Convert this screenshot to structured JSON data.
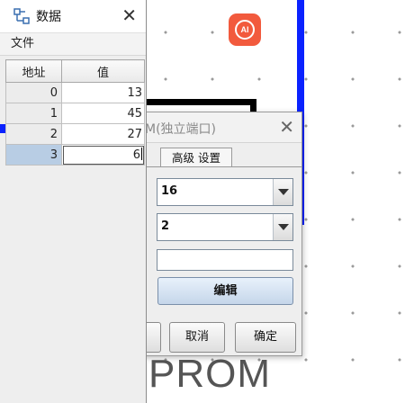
{
  "canvas": {
    "ai_button_label": "AI",
    "component_label": "PROM",
    "big_glyph": "0"
  },
  "data_window": {
    "title": "数据",
    "close_glyph": "✕",
    "menu": {
      "file": "文件"
    },
    "table": {
      "headers": {
        "address": "地址",
        "value": "值"
      },
      "rows": [
        {
          "address": "0",
          "value": "13"
        },
        {
          "address": "1",
          "value": "45"
        },
        {
          "address": "2",
          "value": "27"
        },
        {
          "address": "3",
          "value": "6",
          "selected": true
        }
      ]
    }
  },
  "dialog": {
    "title": "M(独立端口)",
    "close_glyph": "✕",
    "tab_advanced": "高级 设置",
    "combo1_value": "16",
    "combo2_value": "2",
    "edit_button": "编辑",
    "cancel_button": "取消",
    "ok_button": "确定"
  },
  "colors": {
    "ai_button": "#f25a3d",
    "wire_blue": "#0a22ff",
    "selection": "#b8cde4"
  }
}
